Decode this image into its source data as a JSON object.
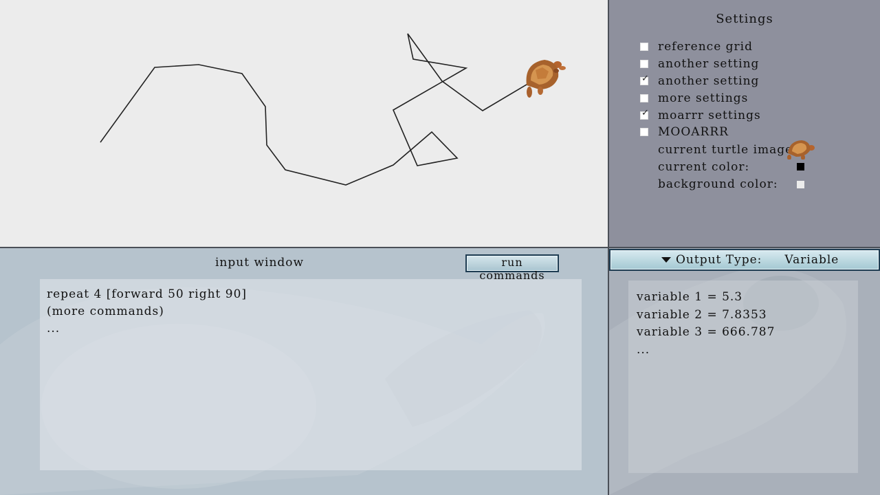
{
  "settings": {
    "title": "Settings",
    "options": [
      {
        "label": "reference grid",
        "checked": false
      },
      {
        "label": "another setting",
        "checked": false
      },
      {
        "label": "another setting",
        "checked": true
      },
      {
        "label": "more settings",
        "checked": false
      },
      {
        "label": "moarrr settings",
        "checked": true
      },
      {
        "label": "MOOARRR",
        "checked": false
      }
    ],
    "turtle_image_label": "current turtle image:",
    "turtle_image_icon": "turtle-icon",
    "current_color_label": "current color:",
    "current_color": "#000000",
    "background_color_label": "background color:",
    "background_color": "#ececec"
  },
  "canvas": {
    "background": "#ececec",
    "line_color": "#222222",
    "turtle_icon": "turtle-icon"
  },
  "input": {
    "title": "input window",
    "run_label": "run commands",
    "lines": [
      "repeat 4 [forward 50 right 90]",
      "(more commands)",
      "..."
    ]
  },
  "output": {
    "type_label": "Output Type:",
    "type_value": "Variable",
    "lines": [
      "variable 1 = 5.3",
      "variable 2 = 7.8353",
      "variable 3 = 666.787",
      "..."
    ]
  }
}
